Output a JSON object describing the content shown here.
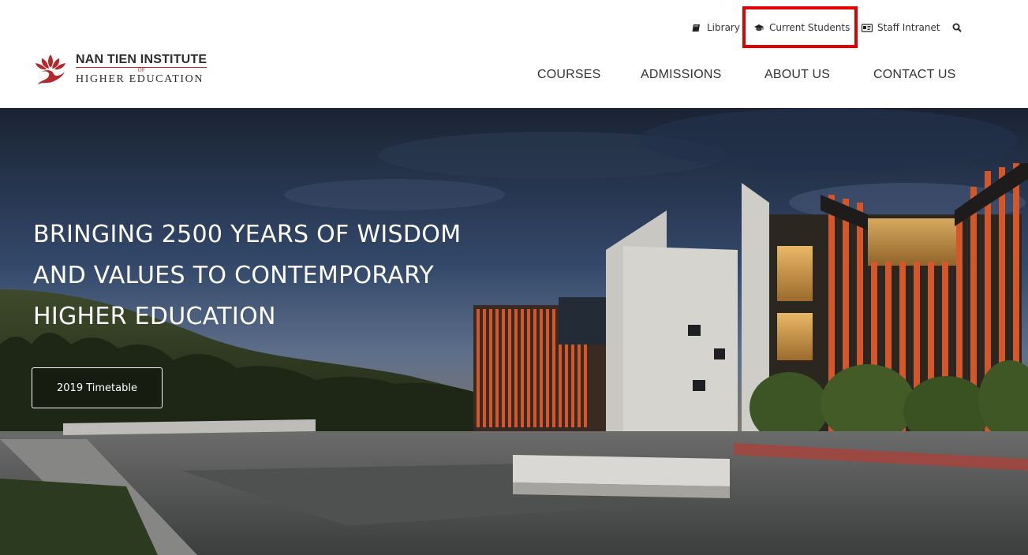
{
  "utility": {
    "library": "Library",
    "current_students": "Current Students",
    "staff_intranet": "Staff Intranet",
    "search_icon": "search-icon"
  },
  "logo": {
    "line1": "NAN TIEN INSTITUTE",
    "of": "OF",
    "line2": "HIGHER EDUCATION"
  },
  "nav": {
    "items": [
      "COURSES",
      "ADMISSIONS",
      "ABOUT US",
      "CONTACT US"
    ]
  },
  "hero": {
    "title_lines": [
      "BRINGING 2500 YEARS OF WISDOM",
      "AND VALUES TO CONTEMPORARY",
      "HIGHER EDUCATION"
    ],
    "button_label": "2019 Timetable"
  },
  "colors": {
    "highlight": "#e10000",
    "brand_red": "#b3282d",
    "building_orange": "#d4562b"
  }
}
